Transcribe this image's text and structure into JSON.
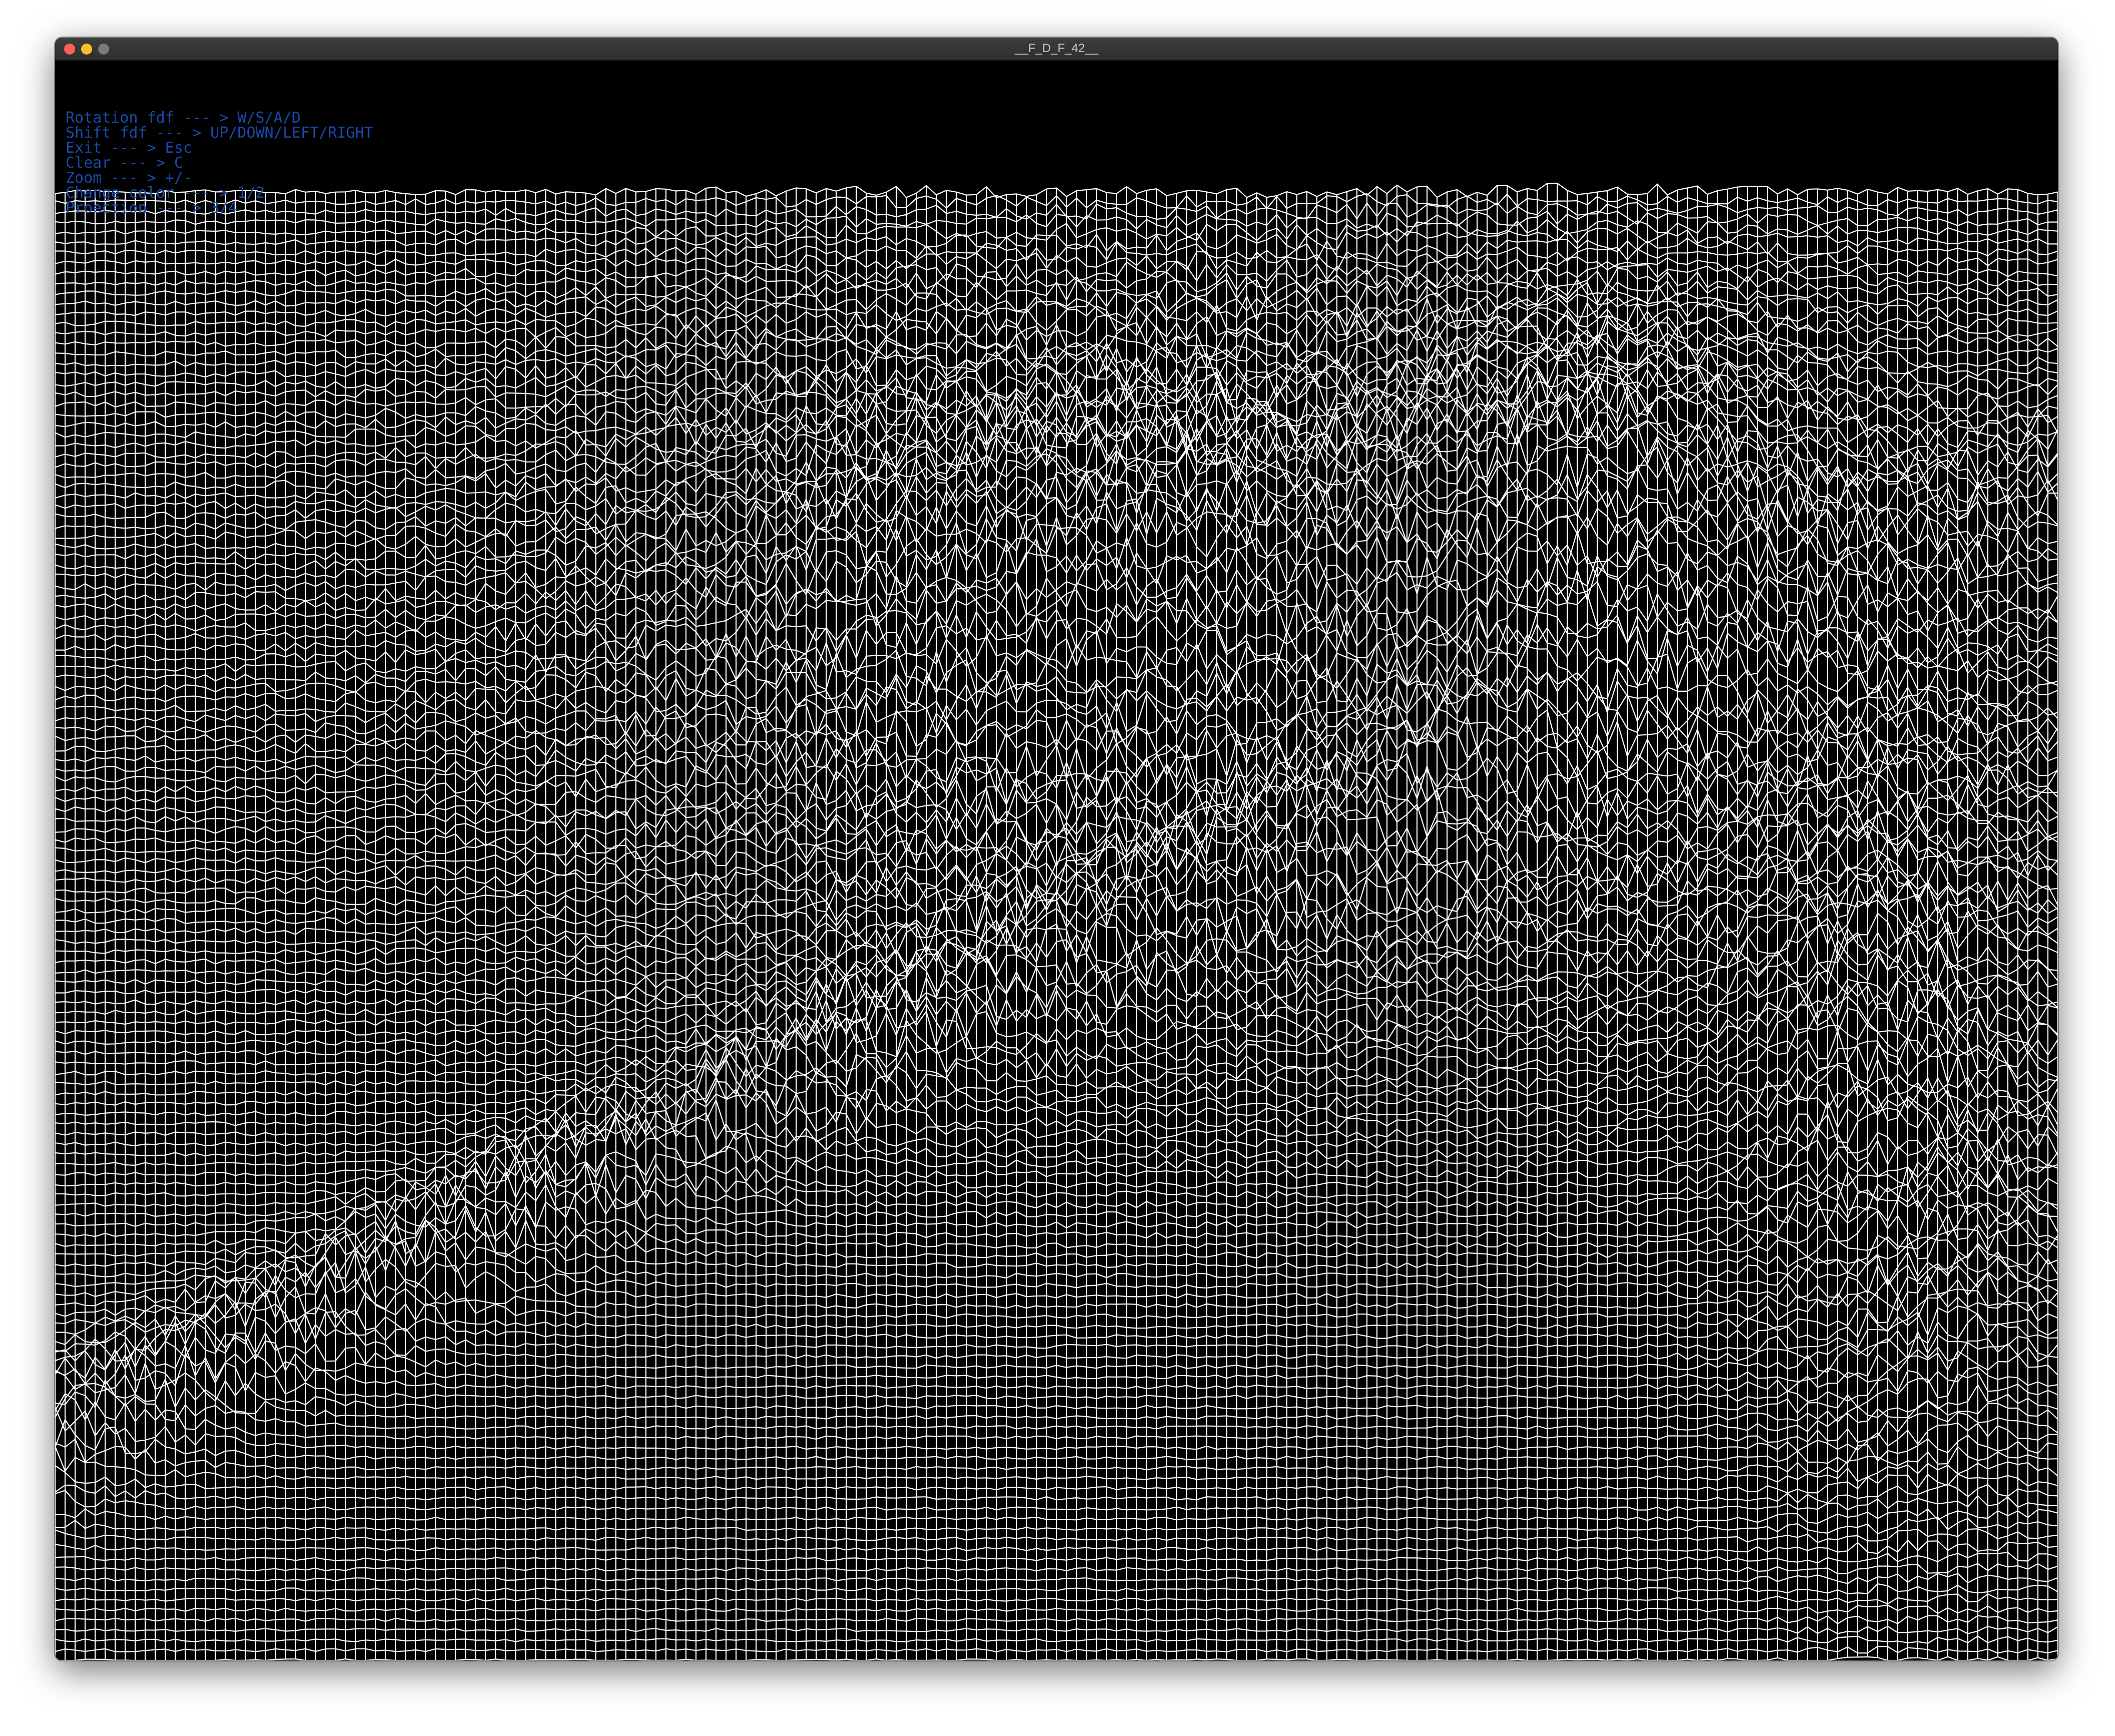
{
  "window": {
    "title": "__F_D_F_42__"
  },
  "help_menu": {
    "lines": [
      "Rotation fdf --- > W/S/A/D",
      "Shift fdf --- > UP/DOWN/LEFT/RIGHT",
      "Exit --- > Esc",
      "Clear --- > C",
      "Zoom --- > +/-",
      "Change color --- > 1/2",
      "Proection --- > 3/4"
    ],
    "text_color": "#1a49a8"
  },
  "wireframe": {
    "line_color": "#ffffff",
    "background_color": "#000000",
    "description_icon": "wireframe-terrain-mesh"
  }
}
